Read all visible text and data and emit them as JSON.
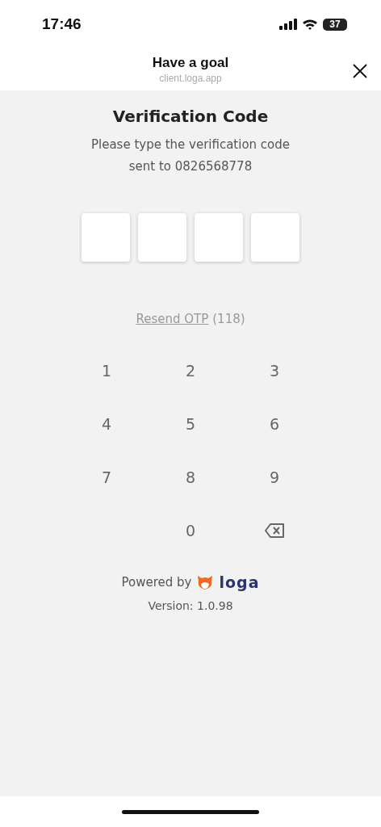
{
  "status_bar": {
    "time": "17:46",
    "battery": "37"
  },
  "header": {
    "title": "Have a goal",
    "subtitle": "client.loga.app"
  },
  "verification": {
    "title": "Verification Code",
    "instruction_line1": "Please type the verification code",
    "instruction_line2": "sent to 0826568778"
  },
  "otp_fields": [
    {
      "filled": false
    },
    {
      "filled": false
    },
    {
      "filled": false
    },
    {
      "filled": false
    }
  ],
  "resend": {
    "link": "Resend OTP",
    "countdown": "(118)"
  },
  "keypad": [
    {
      "kind": "digit",
      "label": "1"
    },
    {
      "kind": "digit",
      "label": "2"
    },
    {
      "kind": "digit",
      "label": "3"
    },
    {
      "kind": "digit",
      "label": "4"
    },
    {
      "kind": "digit",
      "label": "5"
    },
    {
      "kind": "digit",
      "label": "6"
    },
    {
      "kind": "digit",
      "label": "7"
    },
    {
      "kind": "digit",
      "label": "8"
    },
    {
      "kind": "digit",
      "label": "9"
    },
    {
      "kind": "blank"
    },
    {
      "kind": "digit",
      "label": "0"
    },
    {
      "kind": "backspace"
    }
  ],
  "footer": {
    "powered_by": "Powered by",
    "brand": "loga",
    "version": "Version: 1.0.98"
  }
}
